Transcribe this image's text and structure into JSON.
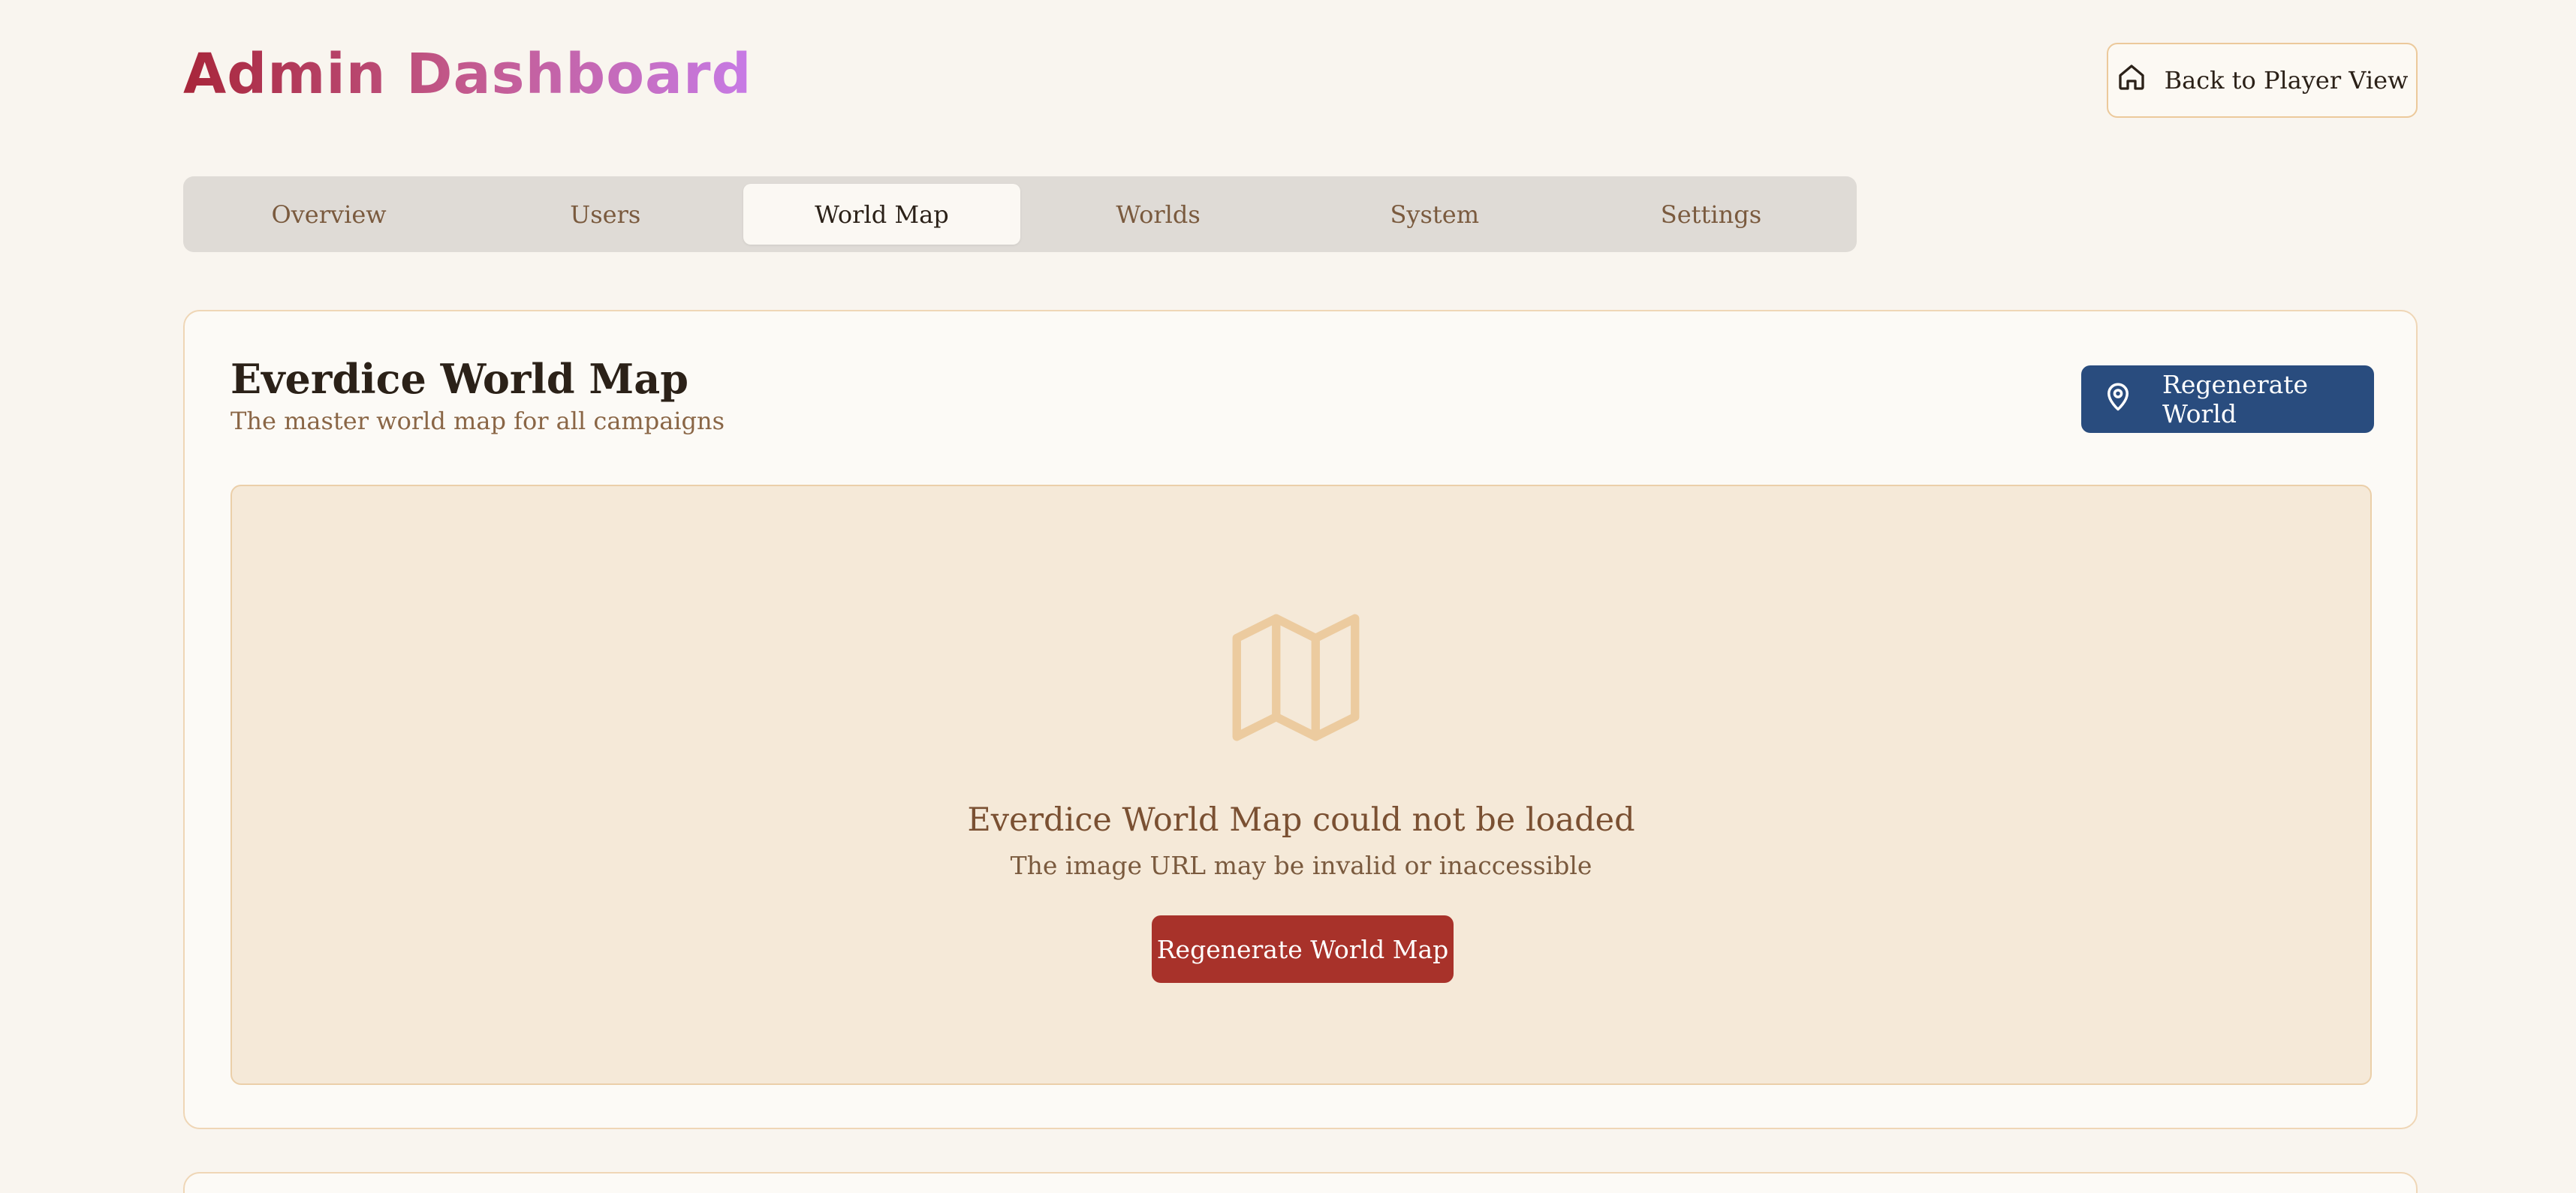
{
  "header": {
    "title": "Admin Dashboard",
    "back_button_label": "Back to Player View",
    "back_icon": "home-icon"
  },
  "tabs": [
    {
      "label": "Overview",
      "active": false
    },
    {
      "label": "Users",
      "active": false
    },
    {
      "label": "World Map",
      "active": true
    },
    {
      "label": "Worlds",
      "active": false
    },
    {
      "label": "System",
      "active": false
    },
    {
      "label": "Settings",
      "active": false
    }
  ],
  "world_map_card": {
    "title": "Everdice World Map",
    "subtitle": "The master world map for all campaigns",
    "regenerate_world_label": "Regenerate World",
    "regenerate_world_icon": "map-pin-icon",
    "map_placeholder": {
      "icon": "map-icon",
      "error_title": "Everdice World Map could not be loaded",
      "error_subtitle": "The image URL may be invalid or inaccessible",
      "regenerate_map_label": "Regenerate World Map"
    }
  },
  "colors": {
    "background": "#f9f5ef",
    "primary_blue": "#294c7e",
    "danger_red": "#a8322a",
    "border_tan": "#efd6b6",
    "title_gradient_start": "#a8263a",
    "title_gradient_end": "#c77be6"
  }
}
